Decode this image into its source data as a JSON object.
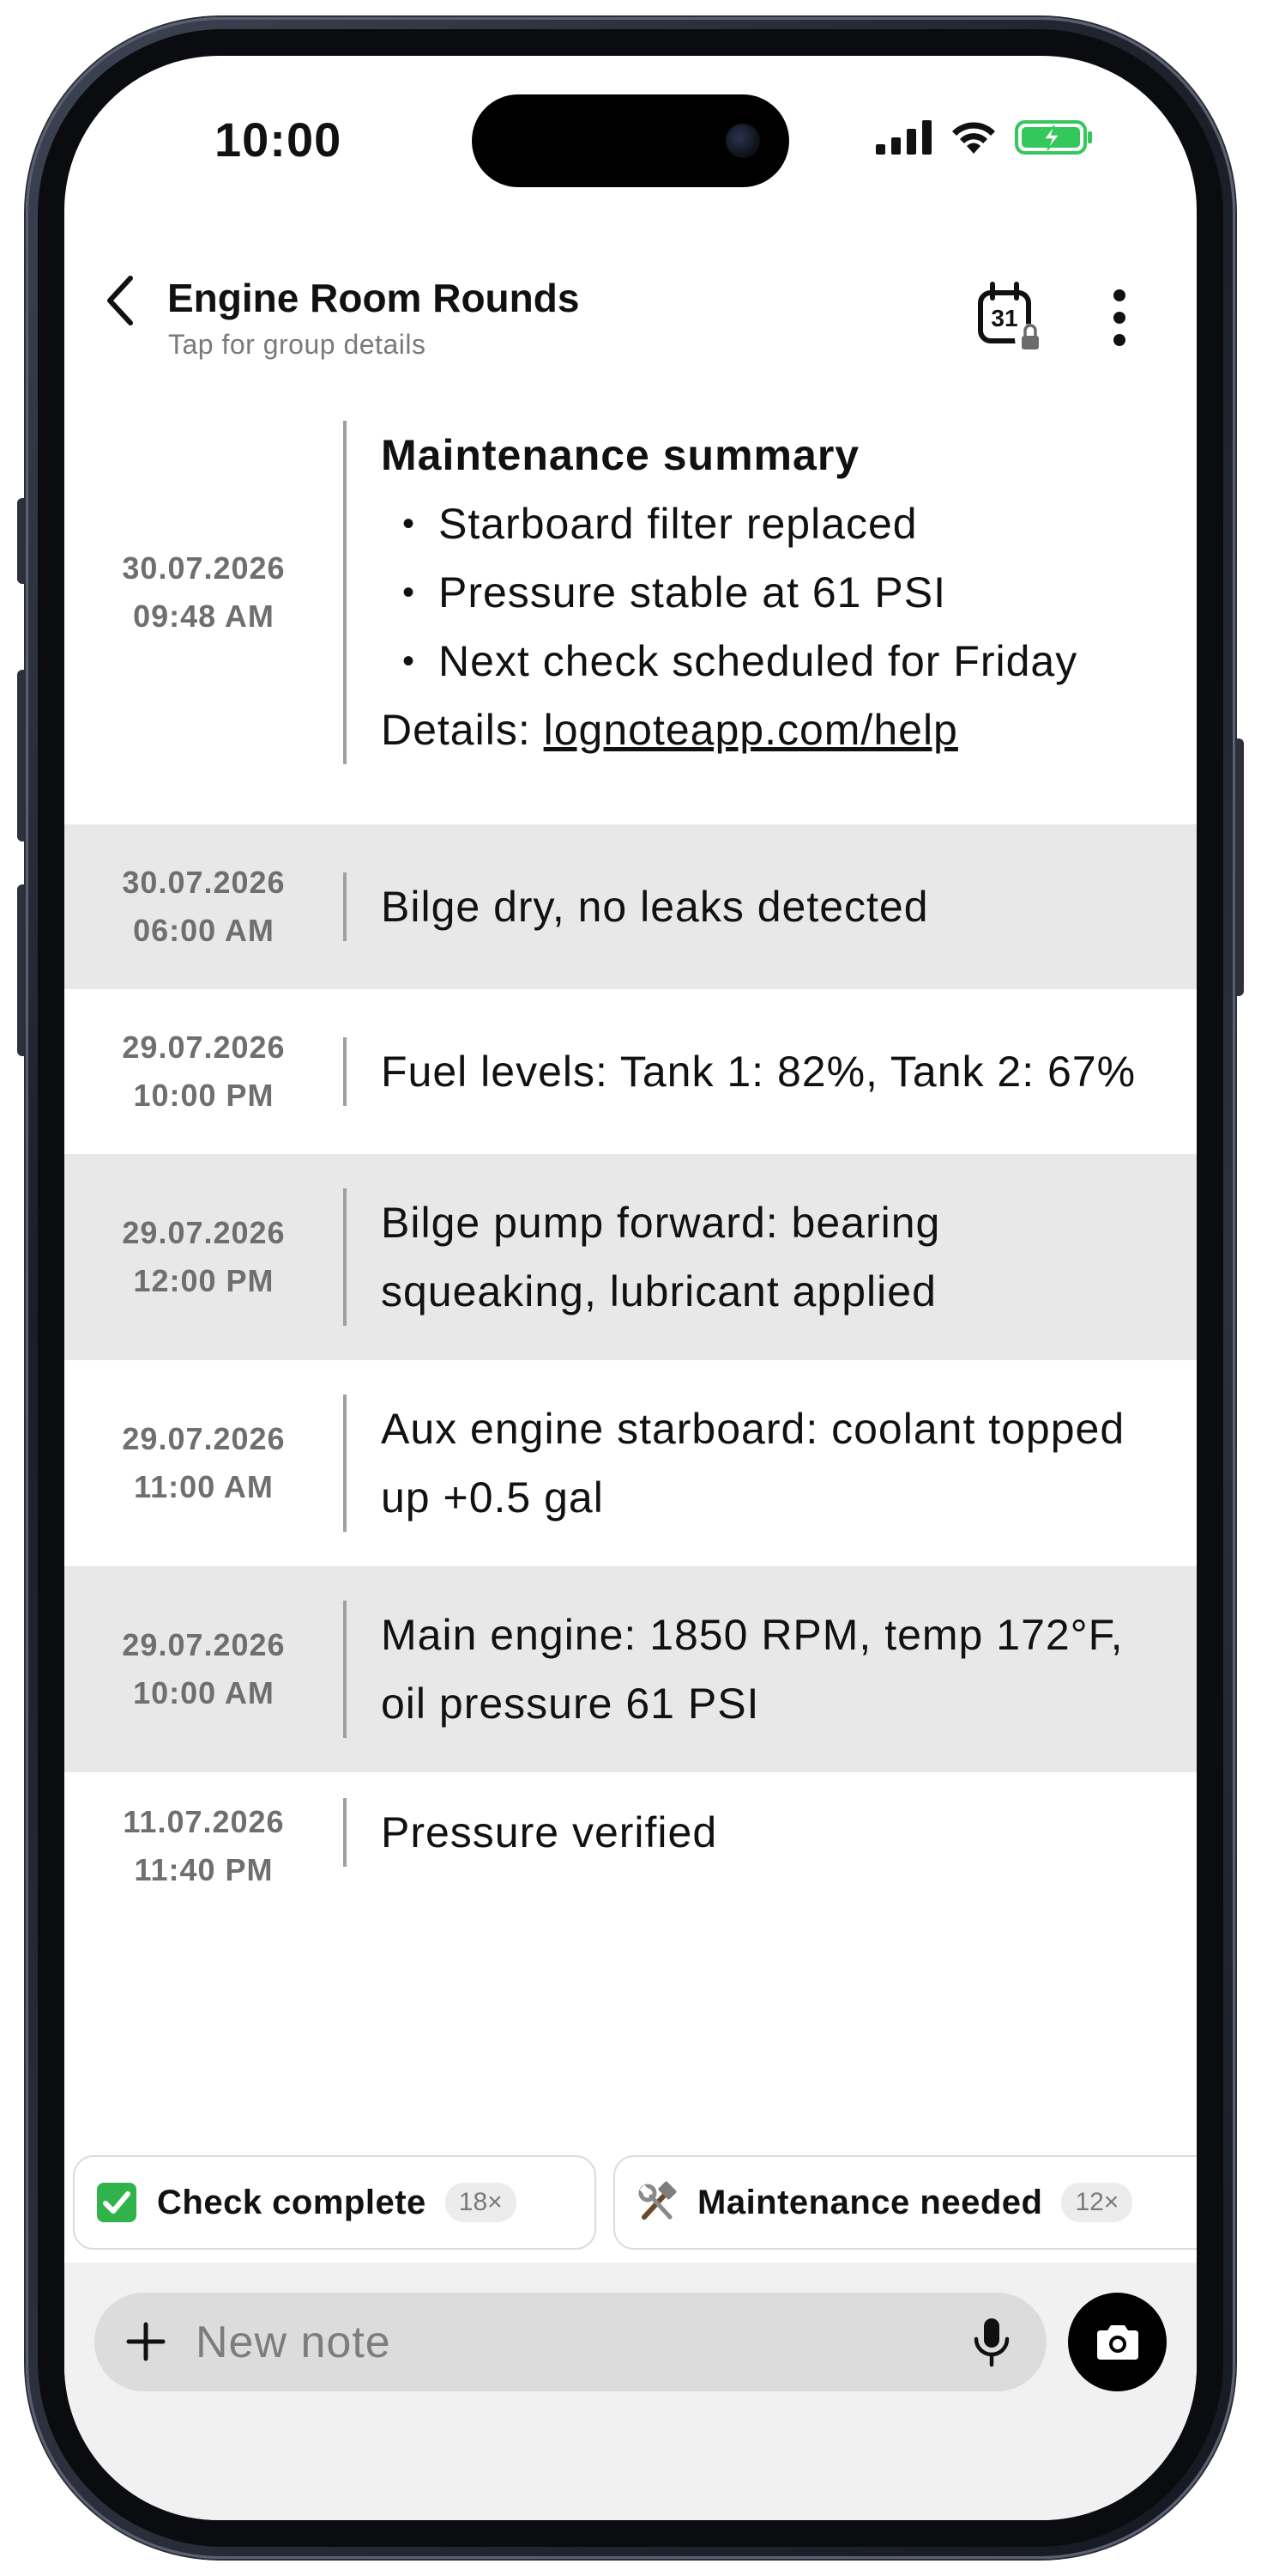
{
  "status_bar": {
    "time": "10:00"
  },
  "header": {
    "title": "Engine Room Rounds",
    "subtitle": "Tap for group details",
    "calendar_day": "31"
  },
  "notes": [
    {
      "date": "30.07.2026",
      "time": "09:48 AM",
      "heading": "Maintenance summary",
      "bullets": [
        "Starboard filter replaced",
        "Pressure stable at 61 PSI",
        "Next check scheduled for Friday"
      ],
      "details_label": "Details: ",
      "details_link": "lognoteapp.com/help",
      "shaded": false
    },
    {
      "date": "30.07.2026",
      "time": "06:00 AM",
      "text": "Bilge dry, no leaks detected",
      "shaded": true
    },
    {
      "date": "29.07.2026",
      "time": "10:00 PM",
      "text": "Fuel levels: Tank 1: 82%, Tank 2: 67%",
      "shaded": false
    },
    {
      "date": "29.07.2026",
      "time": "12:00 PM",
      "text": "Bilge pump forward: bearing squeaking, lubricant applied",
      "shaded": true
    },
    {
      "date": "29.07.2026",
      "time": "11:00 AM",
      "text": "Aux engine starboard: coolant topped up +0.5 gal",
      "shaded": false
    },
    {
      "date": "29.07.2026",
      "time": "10:00 AM",
      "text": "Main engine: 1850 RPM, temp 172°F, oil pressure 61 PSI",
      "shaded": true
    },
    {
      "date": "11.07.2026",
      "time": "11:40 PM",
      "text": "Pressure verified",
      "shaded": false
    }
  ],
  "chips": [
    {
      "icon": "check-mark-icon",
      "label": "Check complete",
      "count": "18×",
      "color": "#2fb34a"
    },
    {
      "icon": "hammer-wrench-icon",
      "label": "Maintenance needed",
      "count": "12×"
    }
  ],
  "composer": {
    "placeholder": "New note"
  },
  "colors": {
    "shaded_row": "#e8e8e8",
    "divider": "#a0a0a0",
    "battery_green": "#34c759"
  }
}
